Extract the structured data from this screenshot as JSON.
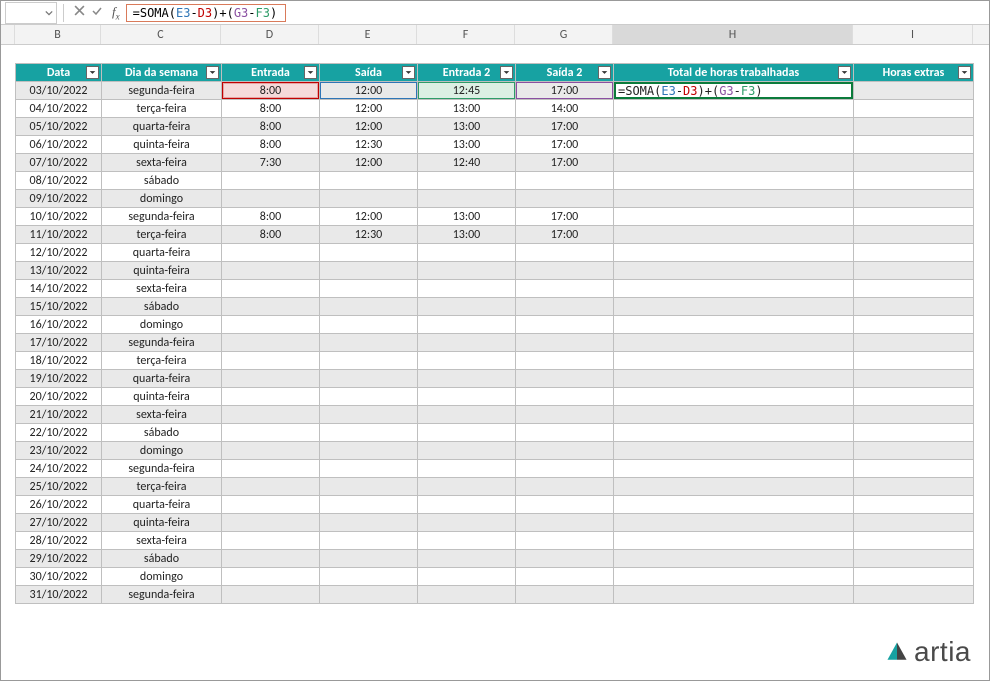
{
  "formula_bar": {
    "formula_plain": "=SOMA(E3-D3)+(G3-F3)"
  },
  "col_headers": {
    "B": "B",
    "C": "C",
    "D": "D",
    "E": "E",
    "F": "F",
    "G": "G",
    "H": "H",
    "I": "I"
  },
  "table": {
    "headers": {
      "data": "Data",
      "dia": "Dia da semana",
      "entrada": "Entrada",
      "saida": "Saída",
      "entrada2": "Entrada 2",
      "saida2": "Saída 2",
      "total": "Total de horas trabalhadas",
      "extras": "Horas extras"
    },
    "rows": [
      {
        "data": "03/10/2022",
        "dia": "segunda-feira",
        "entrada": "8:00",
        "saida": "12:00",
        "entrada2": "12:45",
        "saida2": "17:00",
        "total": "=SOMA(E3-D3)+(G3-F3)",
        "extras": ""
      },
      {
        "data": "04/10/2022",
        "dia": "terça-feira",
        "entrada": "8:00",
        "saida": "12:00",
        "entrada2": "13:00",
        "saida2": "14:00",
        "total": "",
        "extras": ""
      },
      {
        "data": "05/10/2022",
        "dia": "quarta-feira",
        "entrada": "8:00",
        "saida": "12:00",
        "entrada2": "13:00",
        "saida2": "17:00",
        "total": "",
        "extras": ""
      },
      {
        "data": "06/10/2022",
        "dia": "quinta-feira",
        "entrada": "8:00",
        "saida": "12:30",
        "entrada2": "13:00",
        "saida2": "17:00",
        "total": "",
        "extras": ""
      },
      {
        "data": "07/10/2022",
        "dia": "sexta-feira",
        "entrada": "7:30",
        "saida": "12:00",
        "entrada2": "12:40",
        "saida2": "17:00",
        "total": "",
        "extras": ""
      },
      {
        "data": "08/10/2022",
        "dia": "sábado",
        "entrada": "",
        "saida": "",
        "entrada2": "",
        "saida2": "",
        "total": "",
        "extras": ""
      },
      {
        "data": "09/10/2022",
        "dia": "domingo",
        "entrada": "",
        "saida": "",
        "entrada2": "",
        "saida2": "",
        "total": "",
        "extras": ""
      },
      {
        "data": "10/10/2022",
        "dia": "segunda-feira",
        "entrada": "8:00",
        "saida": "12:00",
        "entrada2": "13:00",
        "saida2": "17:00",
        "total": "",
        "extras": ""
      },
      {
        "data": "11/10/2022",
        "dia": "terça-feira",
        "entrada": "8:00",
        "saida": "12:30",
        "entrada2": "13:00",
        "saida2": "17:00",
        "total": "",
        "extras": ""
      },
      {
        "data": "12/10/2022",
        "dia": "quarta-feira",
        "entrada": "",
        "saida": "",
        "entrada2": "",
        "saida2": "",
        "total": "",
        "extras": ""
      },
      {
        "data": "13/10/2022",
        "dia": "quinta-feira",
        "entrada": "",
        "saida": "",
        "entrada2": "",
        "saida2": "",
        "total": "",
        "extras": ""
      },
      {
        "data": "14/10/2022",
        "dia": "sexta-feira",
        "entrada": "",
        "saida": "",
        "entrada2": "",
        "saida2": "",
        "total": "",
        "extras": ""
      },
      {
        "data": "15/10/2022",
        "dia": "sábado",
        "entrada": "",
        "saida": "",
        "entrada2": "",
        "saida2": "",
        "total": "",
        "extras": ""
      },
      {
        "data": "16/10/2022",
        "dia": "domingo",
        "entrada": "",
        "saida": "",
        "entrada2": "",
        "saida2": "",
        "total": "",
        "extras": ""
      },
      {
        "data": "17/10/2022",
        "dia": "segunda-feira",
        "entrada": "",
        "saida": "",
        "entrada2": "",
        "saida2": "",
        "total": "",
        "extras": ""
      },
      {
        "data": "18/10/2022",
        "dia": "terça-feira",
        "entrada": "",
        "saida": "",
        "entrada2": "",
        "saida2": "",
        "total": "",
        "extras": ""
      },
      {
        "data": "19/10/2022",
        "dia": "quarta-feira",
        "entrada": "",
        "saida": "",
        "entrada2": "",
        "saida2": "",
        "total": "",
        "extras": ""
      },
      {
        "data": "20/10/2022",
        "dia": "quinta-feira",
        "entrada": "",
        "saida": "",
        "entrada2": "",
        "saida2": "",
        "total": "",
        "extras": ""
      },
      {
        "data": "21/10/2022",
        "dia": "sexta-feira",
        "entrada": "",
        "saida": "",
        "entrada2": "",
        "saida2": "",
        "total": "",
        "extras": ""
      },
      {
        "data": "22/10/2022",
        "dia": "sábado",
        "entrada": "",
        "saida": "",
        "entrada2": "",
        "saida2": "",
        "total": "",
        "extras": ""
      },
      {
        "data": "23/10/2022",
        "dia": "domingo",
        "entrada": "",
        "saida": "",
        "entrada2": "",
        "saida2": "",
        "total": "",
        "extras": ""
      },
      {
        "data": "24/10/2022",
        "dia": "segunda-feira",
        "entrada": "",
        "saida": "",
        "entrada2": "",
        "saida2": "",
        "total": "",
        "extras": ""
      },
      {
        "data": "25/10/2022",
        "dia": "terça-feira",
        "entrada": "",
        "saida": "",
        "entrada2": "",
        "saida2": "",
        "total": "",
        "extras": ""
      },
      {
        "data": "26/10/2022",
        "dia": "quarta-feira",
        "entrada": "",
        "saida": "",
        "entrada2": "",
        "saida2": "",
        "total": "",
        "extras": ""
      },
      {
        "data": "27/10/2022",
        "dia": "quinta-feira",
        "entrada": "",
        "saida": "",
        "entrada2": "",
        "saida2": "",
        "total": "",
        "extras": ""
      },
      {
        "data": "28/10/2022",
        "dia": "sexta-feira",
        "entrada": "",
        "saida": "",
        "entrada2": "",
        "saida2": "",
        "total": "",
        "extras": ""
      },
      {
        "data": "29/10/2022",
        "dia": "sábado",
        "entrada": "",
        "saida": "",
        "entrada2": "",
        "saida2": "",
        "total": "",
        "extras": ""
      },
      {
        "data": "30/10/2022",
        "dia": "domingo",
        "entrada": "",
        "saida": "",
        "entrada2": "",
        "saida2": "",
        "total": "",
        "extras": ""
      },
      {
        "data": "31/10/2022",
        "dia": "segunda-feira",
        "entrada": "",
        "saida": "",
        "entrada2": "",
        "saida2": "",
        "total": "",
        "extras": ""
      }
    ]
  },
  "logo_text": "artia"
}
